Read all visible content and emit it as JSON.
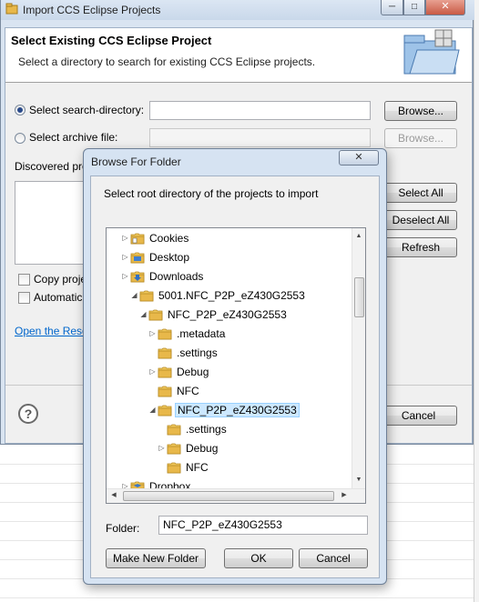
{
  "main_window": {
    "title": "Import CCS Eclipse Projects",
    "banner_title": "Select Existing CCS Eclipse Project",
    "banner_desc": "Select a directory to search for existing CCS Eclipse projects.",
    "search_dir_label": "Select search-directory:",
    "archive_label": "Select archive file:",
    "browse_label": "Browse...",
    "discovered_label": "Discovered pro",
    "select_all": "Select All",
    "deselect_all": "Deselect All",
    "refresh": "Refresh",
    "copy_label": "Copy proje",
    "auto_label": "Automatic",
    "link_label": "Open the Reso",
    "cancel": "Cancel"
  },
  "browse_dialog": {
    "title": "Browse For Folder",
    "description": "Select root directory of the projects to import",
    "tree": [
      {
        "label": "Cookies"
      },
      {
        "label": "Desktop"
      },
      {
        "label": "Downloads"
      },
      {
        "label": "5001.NFC_P2P_eZ430G2553"
      },
      {
        "label": "NFC_P2P_eZ430G2553"
      },
      {
        "label": ".metadata"
      },
      {
        "label": ".settings"
      },
      {
        "label": "Debug"
      },
      {
        "label": "NFC"
      },
      {
        "label": "NFC_P2P_eZ430G2553"
      },
      {
        "label": ".settings"
      },
      {
        "label": "Debug"
      },
      {
        "label": "NFC"
      },
      {
        "label": "Dropbox"
      }
    ],
    "folder_label": "Folder:",
    "folder_value": "NFC_P2P_eZ430G2553",
    "make_new_folder": "Make New Folder",
    "ok": "OK",
    "cancel": "Cancel"
  },
  "icons": {
    "window_icon": "eclipse-app-icon",
    "banner_icon": "import-folder-icon",
    "help_icon": "help-question-icon",
    "folder_icon": "folder-icon"
  },
  "colors": {
    "link": "#0066cc",
    "selection": "#cce8ff",
    "folder": "#e8b84a",
    "close_button": "#c85a45"
  }
}
